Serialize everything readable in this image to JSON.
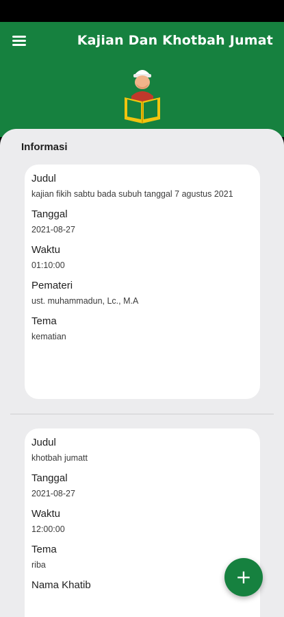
{
  "app_bar": {
    "title": "Kajian Dan Khotbah Jumat",
    "menu_icon": "hamburger-menu-icon",
    "logo_icon": "reading-man-quran-icon",
    "color": "#16813f"
  },
  "section": {
    "title": "Informasi"
  },
  "cards": [
    {
      "fields": [
        {
          "label": "Judul",
          "value": "kajian fikih sabtu bada subuh tanggal 7 agustus 2021"
        },
        {
          "label": "Tanggal",
          "value": "2021-08-27"
        },
        {
          "label": "Waktu",
          "value": "01:10:00"
        },
        {
          "label": "Pemateri",
          "value": "ust. muhammadun, Lc., M.A"
        },
        {
          "label": "Tema",
          "value": "kematian"
        }
      ]
    },
    {
      "fields": [
        {
          "label": "Judul",
          "value": "khotbah jumatt"
        },
        {
          "label": "Tanggal",
          "value": "2021-08-27"
        },
        {
          "label": "Waktu",
          "value": "12:00:00"
        },
        {
          "label": "Tema",
          "value": "riba"
        },
        {
          "label": "Nama Khatib",
          "value": ""
        }
      ]
    }
  ],
  "fab": {
    "icon": "plus-icon",
    "label": "+"
  }
}
